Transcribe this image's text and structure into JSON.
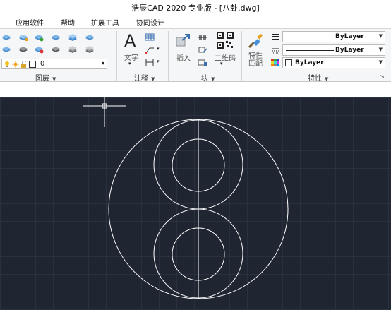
{
  "window": {
    "title": "浩辰CAD 2020 专业版 - [八卦.dwg]"
  },
  "menu": {
    "items": [
      {
        "label": "应用软件"
      },
      {
        "label": "帮助"
      },
      {
        "label": "扩展工具"
      },
      {
        "label": "协同设计"
      }
    ]
  },
  "ribbon": {
    "layers": {
      "panel_label": "图层",
      "current_layer": "0"
    },
    "annotation": {
      "panel_label": "注释",
      "text_button": "文字"
    },
    "block": {
      "panel_label": "块",
      "insert_button": "插入",
      "qrcode_button": "二维码"
    },
    "properties": {
      "panel_label": "特性",
      "match_button": "特性匹配",
      "linetype_value": "ByLayer",
      "lineweight_value": "ByLayer",
      "color_value": "ByLayer"
    }
  },
  "colors": {
    "canvas_bg": "#1f2531",
    "grid": "#2a313e",
    "drawing": "#ffffff",
    "ribbon_bg": "#f5f6f7"
  }
}
